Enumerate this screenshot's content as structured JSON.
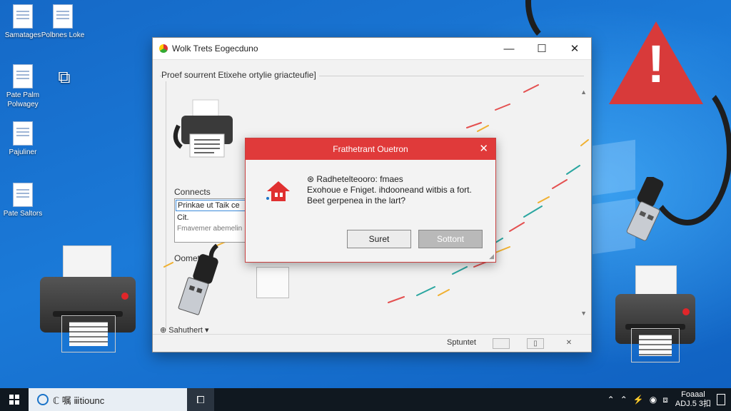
{
  "desktop": {
    "icons": [
      {
        "label": "Samatages"
      },
      {
        "label": "Polbnes Loke"
      },
      {
        "label": ""
      },
      {
        "label": "Pate Palm Polwagey"
      },
      {
        "label": "Pajuliner"
      },
      {
        "label": "Pate Saltors"
      }
    ]
  },
  "window": {
    "title": "Wolk Trets Eogecduno",
    "controls": {
      "minimize": "—",
      "maximize": "☐",
      "close": "✕"
    },
    "section_header": "Proef sourrent Etixehe ortylie griacteufie]",
    "connects_label": "Connects",
    "listbox": {
      "items": [
        "Prinkae ut Taik ce",
        "Cit.",
        "Fmavemer abemelin"
      ]
    },
    "oomet_label": "Oomet",
    "settings_label": "Sahuthert",
    "status_text": "Sptuntet"
  },
  "dialog": {
    "title": "Frathetrant Ouetron",
    "close": "✕",
    "lines": [
      "Radhetelteooro: fmaes",
      "Exohoue e Fniget. ihdooneand witbis a fort.",
      "Beet gerpenea in the lart?"
    ],
    "buttons": {
      "primary": "Suret",
      "secondary": "Sottont"
    }
  },
  "taskbar": {
    "search_text": "ℂ 嘱 ⅲtiounc",
    "clock_line1": "Foaaal",
    "clock_line2": "ADJ.5 3扣"
  },
  "colors": {
    "dialog_header": "#e03a3a",
    "desktop_bg": "#1569c7",
    "warning": "#d83a3a"
  }
}
